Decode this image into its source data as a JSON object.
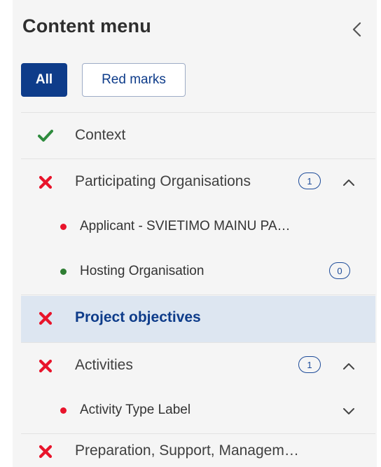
{
  "header": {
    "title": "Content menu"
  },
  "filters": {
    "all_label": "All",
    "red_marks_label": "Red marks"
  },
  "colors": {
    "primary": "#0e3c8a",
    "check_green": "#2e8b3e",
    "error_red": "#e8142b",
    "active_bg": "#dde6f1",
    "panel_bg": "#f5f5f5"
  },
  "menu": {
    "context": {
      "label": "Context",
      "status": "complete",
      "icon": "check-icon"
    },
    "participating_organisations": {
      "label": "Participating Organisations",
      "status": "error",
      "icon": "cross-icon",
      "badge": "1",
      "expanded": true,
      "children": [
        {
          "label": "Applicant - SVIETIMO MAINU PA…",
          "status": "error"
        },
        {
          "label": "Hosting Organisation",
          "status": "complete",
          "badge": "0"
        }
      ]
    },
    "project_objectives": {
      "label": "Project objectives",
      "status": "error",
      "icon": "cross-icon",
      "active": true
    },
    "activities": {
      "label": "Activities",
      "status": "error",
      "icon": "cross-icon",
      "badge": "1",
      "expanded": true,
      "children": [
        {
          "label": "Activity Type Label",
          "status": "error",
          "expanded": false
        }
      ]
    },
    "preparation": {
      "label": "Preparation, Support, Managem…",
      "status": "error",
      "icon": "cross-icon"
    }
  }
}
